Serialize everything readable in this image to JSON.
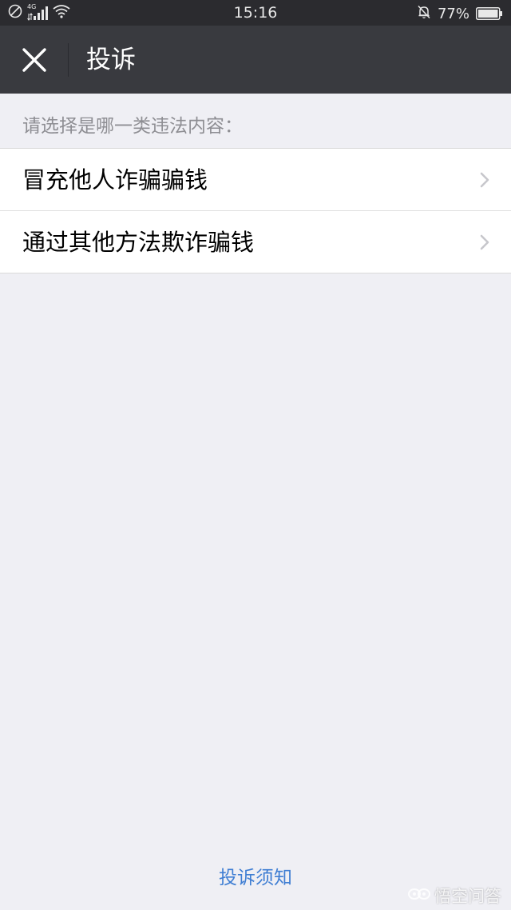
{
  "status_bar": {
    "network": "4G",
    "time": "15:16",
    "battery": "77%",
    "battery_level": 0.77,
    "icons": [
      "do-not-disturb-icon",
      "signal-icon",
      "wifi-icon",
      "muted-bell-icon",
      "battery-icon"
    ]
  },
  "header": {
    "title": "投诉",
    "close_icon": "close-icon"
  },
  "prompt": "请选择是哪一类违法内容：",
  "options": [
    {
      "label": "冒充他人诈骗骗钱",
      "icon": "chevron-right-icon"
    },
    {
      "label": "通过其他方法欺诈骗钱",
      "icon": "chevron-right-icon"
    }
  ],
  "footer": {
    "link": "投诉须知"
  },
  "watermark": {
    "text": "悟空问答",
    "icon": "wukong-logo"
  },
  "colors": {
    "status_bar": "#2b2b2f",
    "header": "#393a3f",
    "background": "#efeff4",
    "link": "#3f7ed3"
  }
}
